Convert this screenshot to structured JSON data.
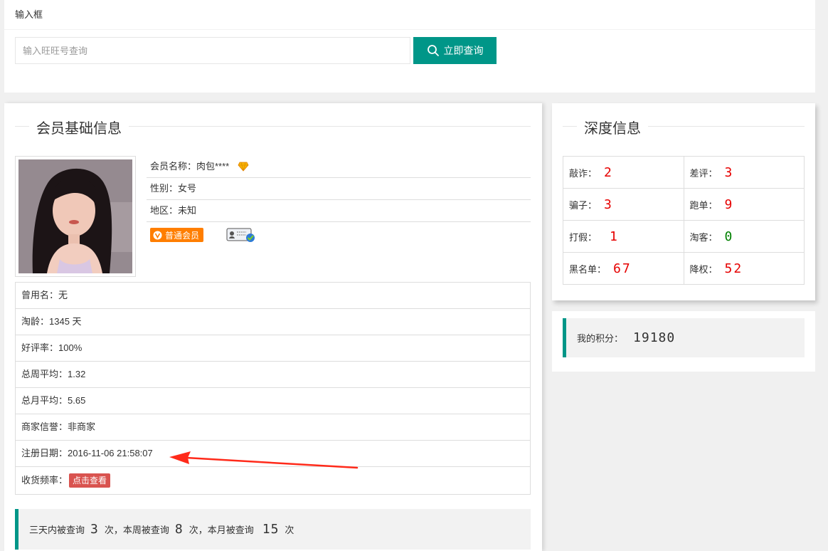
{
  "search": {
    "header": "输入框",
    "placeholder": "输入旺旺号查询",
    "button_label": "立即查询"
  },
  "basic": {
    "title": "会员基础信息",
    "name": "会员名称：肉包****",
    "gender": "性别：女号",
    "region": "地区：未知",
    "member_badge": "普通会员",
    "rows": [
      "曾用名：无",
      "淘龄：1345 天",
      "好评率：100%",
      "总周平均：1.32",
      "总月平均：5.65",
      "商家信誉：非商家",
      "注册日期：2016-11-06 21:58:07"
    ],
    "receive_label": "收货频率：",
    "receive_button": "点击查看",
    "query_counts": {
      "p1": "三天内被查询",
      "v1": "3",
      "p2": "次，本周被查询",
      "v2": "8",
      "p3": "次，本月被查询",
      "v3": "15",
      "p4": "次"
    }
  },
  "deep": {
    "title": "深度信息",
    "items": [
      {
        "label": "敲诈：",
        "value": "2",
        "color": "#e60000"
      },
      {
        "label": "差评：",
        "value": "3",
        "color": "#e60000"
      },
      {
        "label": "骗子：",
        "value": "3",
        "color": "#e60000"
      },
      {
        "label": "跑单：",
        "value": "9",
        "color": "#e60000"
      },
      {
        "label": "打假：",
        "value": "1",
        "color": "#e60000"
      },
      {
        "label": "淘客：",
        "value": "0",
        "color": "#008000"
      },
      {
        "label": "黑名单：",
        "value": "67",
        "color": "#e60000"
      },
      {
        "label": "降权：",
        "value": "52",
        "color": "#e60000"
      }
    ]
  },
  "score": {
    "label": "我的积分：",
    "value": "19180"
  },
  "colors": {
    "accent": "#009688",
    "badge": "#ff7e00",
    "danger": "#d9534f",
    "arrow": "#ff2a1a"
  }
}
